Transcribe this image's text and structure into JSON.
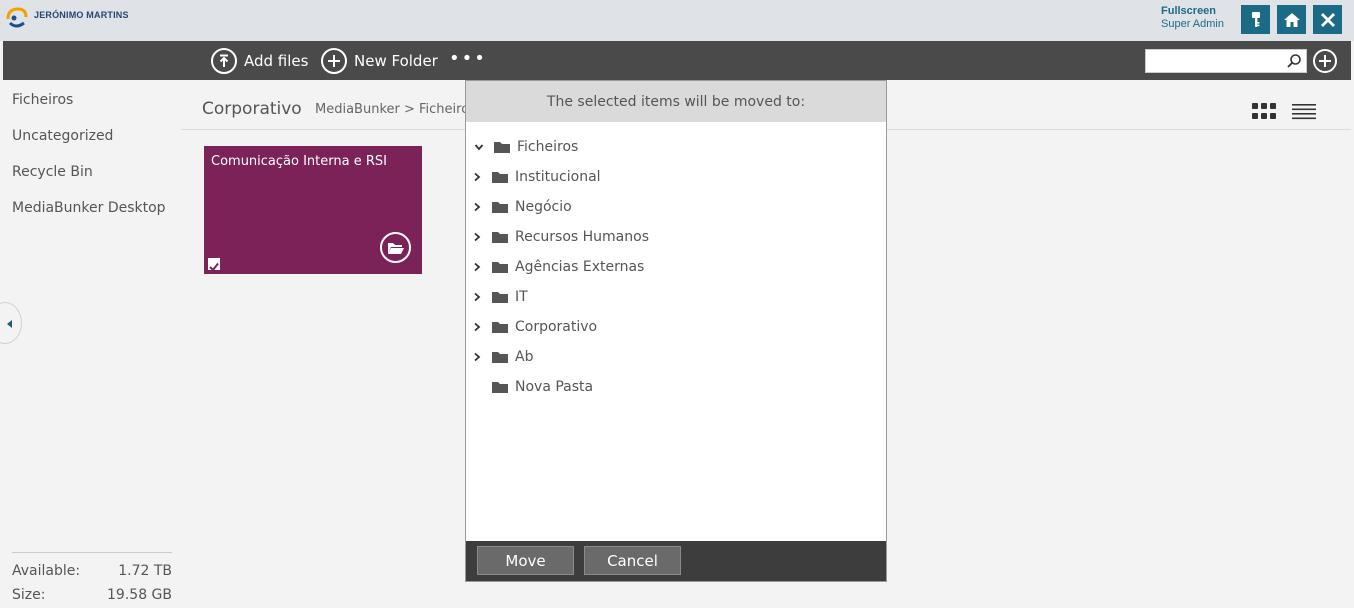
{
  "brand": {
    "name": "JERÓNIMO MARTINS"
  },
  "user": {
    "fullscreen_label": "Fullscreen",
    "role": "Super Admin"
  },
  "top_buttons": {
    "key": "key-icon",
    "home": "home-icon",
    "close": "close-icon"
  },
  "toolbar": {
    "add_files": "Add files",
    "new_folder": "New Folder",
    "more": "•••",
    "search_placeholder": ""
  },
  "sidebar": {
    "items": [
      "Ficheiros",
      "Uncategorized",
      "Recycle Bin",
      "MediaBunker Desktop"
    ],
    "storage": {
      "available_label": "Available:",
      "available_value": "1.72 TB",
      "size_label": "Size:",
      "size_value": "19.58 GB"
    }
  },
  "main": {
    "title": "Corporativo",
    "path": "MediaBunker  > Ficheiros",
    "tile": {
      "name": "Comunicação Interna e RSI",
      "checked": true
    }
  },
  "dialog": {
    "header": "The selected items will be moved to:",
    "tree": [
      {
        "label": "Ficheiros",
        "expanded": true,
        "level": 0
      },
      {
        "label": "Institucional",
        "expanded": false,
        "level": 1
      },
      {
        "label": "Negócio",
        "expanded": false,
        "level": 1
      },
      {
        "label": "Recursos Humanos",
        "expanded": false,
        "level": 1
      },
      {
        "label": "Agências Externas",
        "expanded": false,
        "level": 1
      },
      {
        "label": "IT",
        "expanded": false,
        "level": 1
      },
      {
        "label": "Corporativo",
        "expanded": false,
        "level": 1
      },
      {
        "label": "Ab",
        "expanded": false,
        "level": 1
      },
      {
        "label": "Nova Pasta",
        "expanded": null,
        "level": 1
      }
    ],
    "move_label": "Move",
    "cancel_label": "Cancel"
  },
  "colors": {
    "accent": "#1b6b86",
    "toolbar": "#4a4a4a",
    "tile": "#7b2258",
    "dialog_header": "#dadada",
    "dialog_footer": "#3d3d3d"
  }
}
